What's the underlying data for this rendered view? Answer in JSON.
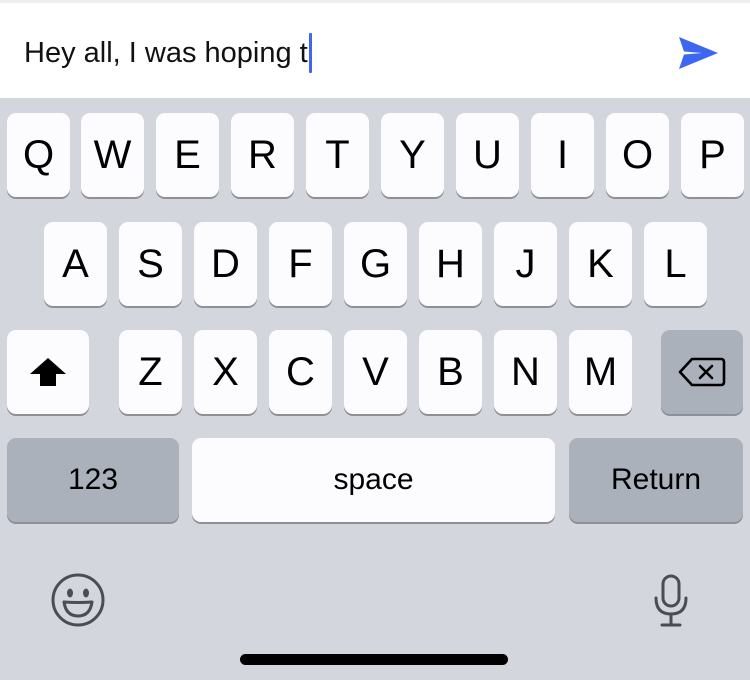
{
  "input": {
    "text": "Hey all, I was hoping t"
  },
  "icons": {
    "send": "send-icon",
    "shift": "shift-icon",
    "backspace": "backspace-icon",
    "emoji": "emoji-icon",
    "microphone": "microphone-icon"
  },
  "keyboard": {
    "row1": [
      "Q",
      "W",
      "E",
      "R",
      "T",
      "Y",
      "U",
      "I",
      "O",
      "P"
    ],
    "row2": [
      "A",
      "S",
      "D",
      "F",
      "G",
      "H",
      "J",
      "K",
      "L"
    ],
    "row3": [
      "Z",
      "X",
      "C",
      "V",
      "B",
      "N",
      "M"
    ],
    "numbers_label": "123",
    "space_label": "space",
    "return_label": "Return"
  },
  "colors": {
    "accent": "#3d67f2",
    "keyboard_bg": "#d3d6dc",
    "key_light": "#fcfcfe",
    "key_dark": "#abb1ba"
  }
}
